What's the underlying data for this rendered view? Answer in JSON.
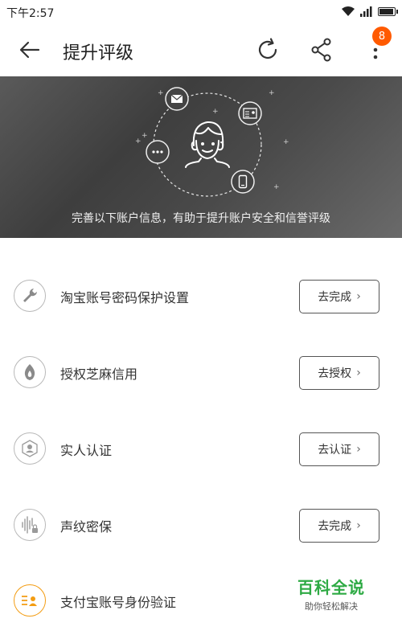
{
  "status_bar": {
    "time": "下午2:57",
    "icons": [
      "wifi-icon",
      "signal-icon",
      "battery-icon"
    ],
    "battery_level": 0.85
  },
  "header": {
    "title": "提升评级",
    "back_icon": "arrow-left-icon",
    "refresh_icon": "refresh-icon",
    "share_icon": "share-icon",
    "more_icon": "more-vertical-icon",
    "badge_count": "8"
  },
  "banner": {
    "text": "完善以下账户信息，有助于提升账户安全和信誉评级",
    "icons": [
      "mail-icon",
      "id-card-icon",
      "chat-icon",
      "phone-icon",
      "avatar-icon"
    ]
  },
  "items": [
    {
      "label": "淘宝账号密码保护设置",
      "button": "去完成",
      "icon": "wrench-icon"
    },
    {
      "label": "授权芝麻信用",
      "button": "去授权",
      "icon": "sesame-icon"
    },
    {
      "label": "实人认证",
      "button": "去认证",
      "icon": "face-id-icon"
    },
    {
      "label": "声纹密保",
      "button": "去完成",
      "icon": "voiceprint-icon"
    },
    {
      "label": "支付宝账号身份验证",
      "button": "",
      "icon": "id-card-icon"
    }
  ],
  "watermark": {
    "title": "百科全说",
    "subtitle": "助你轻松解决"
  },
  "colors": {
    "accent": "#ff5a00",
    "alipay_icon": "#f39c12",
    "watermark": "#2eaa44"
  }
}
